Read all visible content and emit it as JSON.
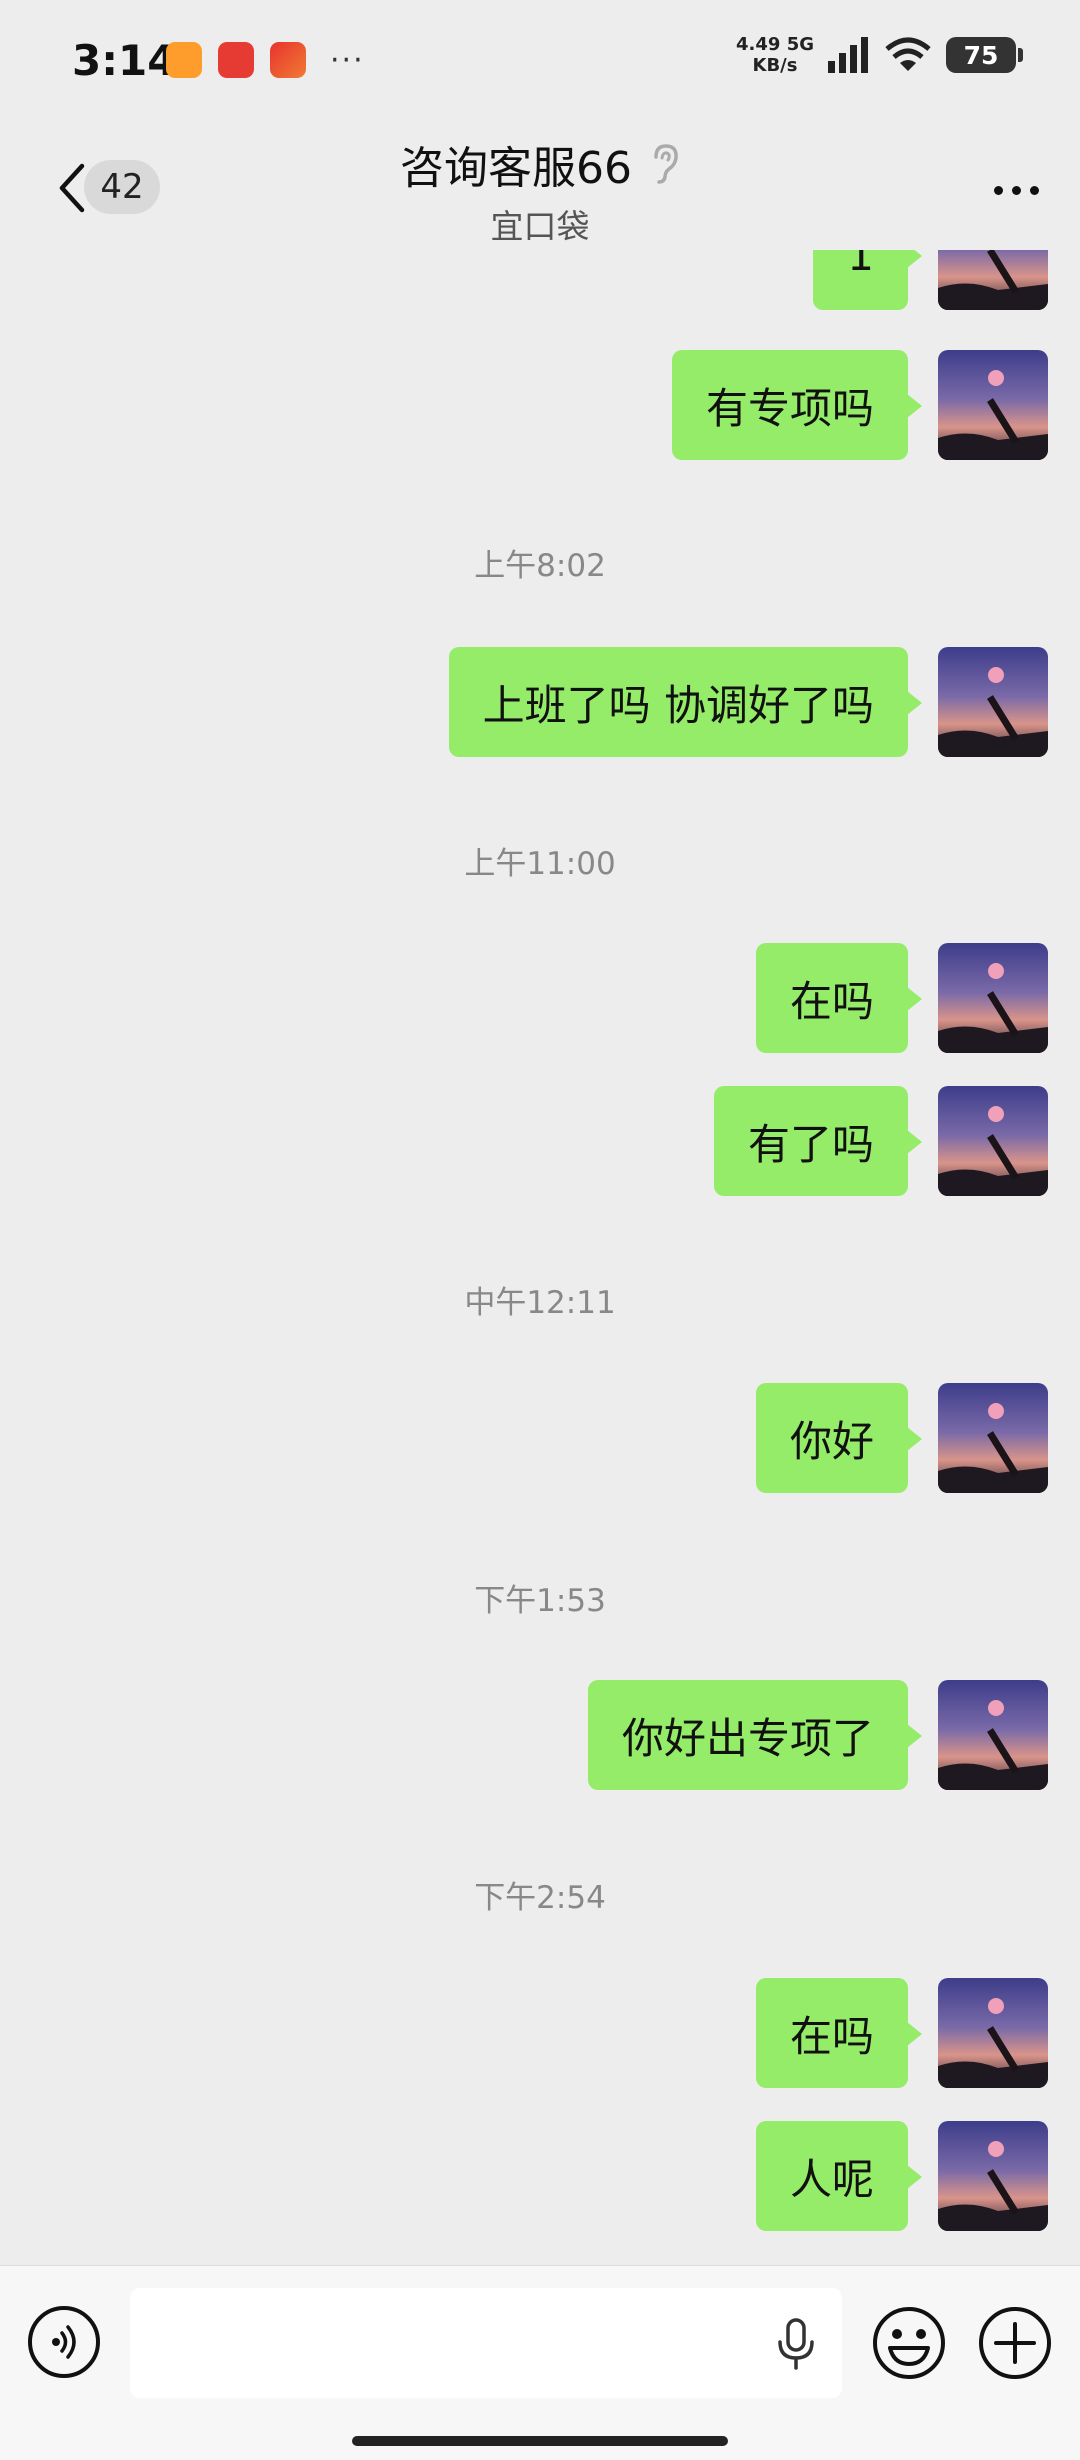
{
  "status_bar": {
    "time": "3:14",
    "more_dots": "···",
    "network_speed_value": "4.49",
    "network_speed_unit": "KB/s",
    "network_type": "5G",
    "battery": "75"
  },
  "header": {
    "unread_count": "42",
    "title": "咨询客服66",
    "subtitle": "宜口袋"
  },
  "messages": {
    "m0": "1",
    "m1": "有专项吗",
    "t1": "上午8:02",
    "m2": "上班了吗 协调好了吗",
    "t2": "上午11:00",
    "m3": "在吗",
    "m4": "有了吗",
    "t3": "中午12:11",
    "m5": "你好",
    "t4": "下午1:53",
    "m6": "你好出专项了",
    "t5": "下午2:54",
    "m7": "在吗",
    "m8": "人呢"
  },
  "colors": {
    "background": "#ededed",
    "bubble_self": "#95ec69",
    "timestamp": "#888888"
  },
  "icons": [
    "back-icon",
    "ear-icon",
    "more-icon",
    "voice-icon",
    "mic-icon",
    "emoji-icon",
    "plus-icon"
  ]
}
